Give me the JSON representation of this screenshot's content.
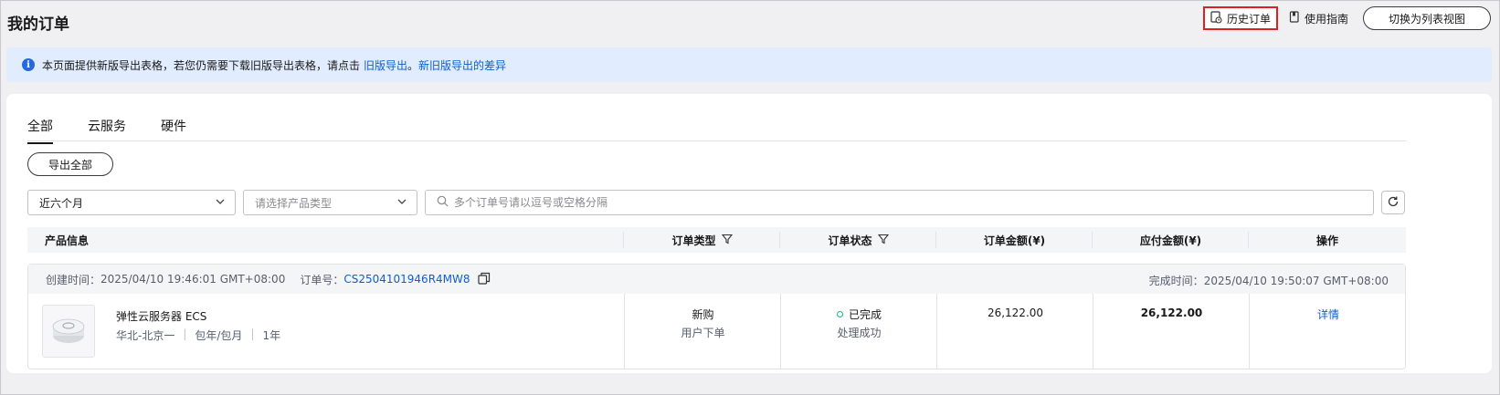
{
  "page": {
    "title": "我的订单"
  },
  "top_actions": {
    "history_label": "历史订单",
    "guide_label": "使用指南",
    "switch_label": "切换为列表视图"
  },
  "notice": {
    "text": "本页面提供新版导出表格，若您仍需要下载旧版导出表格，请点击",
    "old_export_link": "旧版导出",
    "period": "。",
    "diff_link": "新旧版导出的差异"
  },
  "tabs": [
    {
      "label": "全部",
      "active": true
    },
    {
      "label": "云服务",
      "active": false
    },
    {
      "label": "硬件",
      "active": false
    }
  ],
  "export_all_label": "导出全部",
  "filters": {
    "period_value": "近六个月",
    "product_type_placeholder": "请选择产品类型",
    "search_placeholder": "多个订单号请以逗号或空格分隔"
  },
  "table": {
    "columns": [
      "产品信息",
      "订单类型",
      "订单状态",
      "订单金额(¥)",
      "应付金额(¥)",
      "操作"
    ]
  },
  "order": {
    "created_label": "创建时间：",
    "created_value": "2025/04/10 19:46:01 GMT+08:00",
    "order_no_label": "订单号：",
    "order_no": "CS2504101946R4MW8",
    "completed_label": "完成时间：",
    "completed_value": "2025/04/10 19:50:07 GMT+08:00",
    "product_name": "弹性云服务器 ECS",
    "region": "华北-北京一",
    "billing": "包年/包月",
    "duration": "1年",
    "order_type": "新购",
    "order_type_sub": "用户下单",
    "status": "已完成",
    "status_sub": "处理成功",
    "amount": "26,122.00",
    "payable": "26,122.00",
    "action": "详情"
  },
  "colors": {
    "link": "#0d5fcf",
    "status_ok": "#22b08c",
    "highlight_border": "#e02020"
  }
}
